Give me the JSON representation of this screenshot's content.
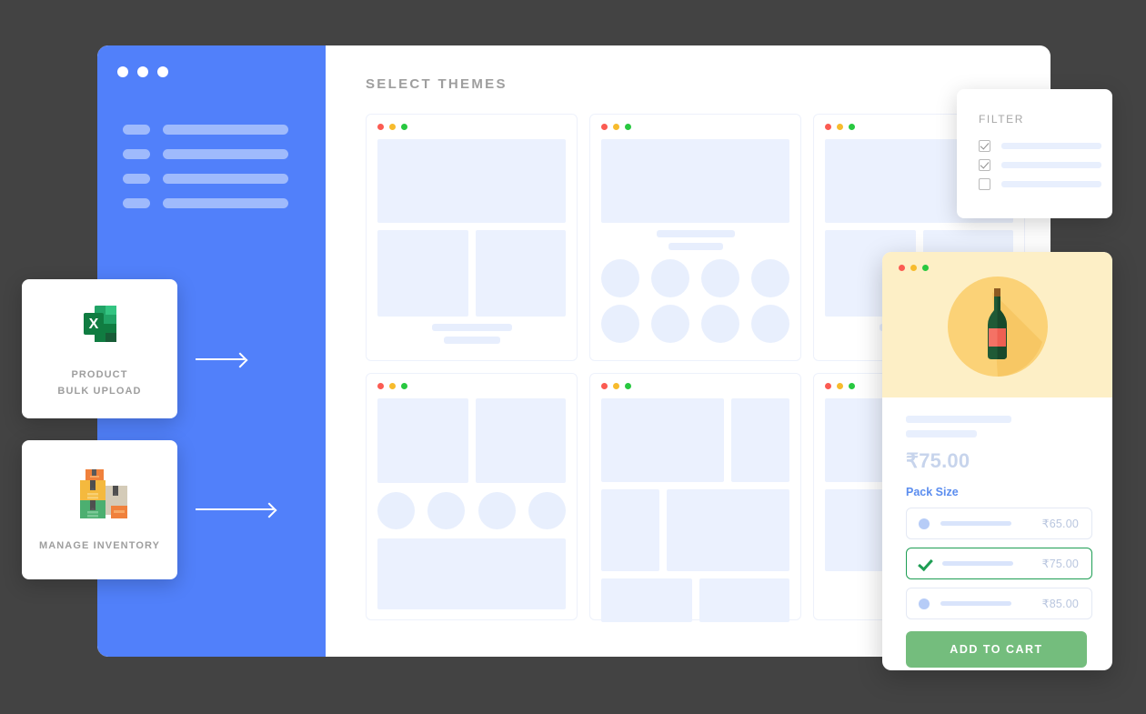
{
  "theme": {
    "page_background": "#434343",
    "sidebar_blue": "#5180FA",
    "accent_blue": "#5B8DEF",
    "skeleton_blue": "#EBF1FE",
    "green_selected": "#1E9E54",
    "cart_green": "#74BD7D",
    "hero_cream": "#FDEFC6"
  },
  "app": {
    "window_dots": [
      "dot-1",
      "dot-2",
      "dot-3"
    ],
    "sidebar": {
      "nav_items": [
        {
          "id": "nav-item-1"
        },
        {
          "id": "nav-item-2"
        },
        {
          "id": "nav-item-3"
        },
        {
          "id": "nav-item-4"
        }
      ]
    },
    "content": {
      "section_title": "SELECT THEMES",
      "theme_cards": [
        {
          "id": "theme-card-1",
          "layout": "hero-split-text"
        },
        {
          "id": "theme-card-2",
          "layout": "hero-text-circles"
        },
        {
          "id": "theme-card-3",
          "layout": "hero-split-text"
        },
        {
          "id": "theme-card-4",
          "layout": "split-circles-wide"
        },
        {
          "id": "theme-card-5",
          "layout": "masonry"
        },
        {
          "id": "theme-card-6",
          "layout": "stacked-blocks"
        }
      ],
      "card_dots": [
        "red",
        "yellow",
        "green"
      ]
    }
  },
  "feature_cards": [
    {
      "id": "card-bulk-upload",
      "icon": "excel-file-icon",
      "label_line1": "PRODUCT",
      "label_line2": "BULK UPLOAD",
      "arrow": "arrow-right-icon"
    },
    {
      "id": "card-inventory",
      "icon": "stacked-boxes-icon",
      "label_line1": "MANAGE INVENTORY",
      "label_line2": "",
      "arrow": "arrow-right-icon"
    }
  ],
  "filter_panel": {
    "title": "FILTER",
    "options": [
      {
        "id": "filter-option-1",
        "checked": true
      },
      {
        "id": "filter-option-2",
        "checked": true
      },
      {
        "id": "filter-option-3",
        "checked": false
      }
    ]
  },
  "product_panel": {
    "window_dots": [
      "red",
      "yellow",
      "green"
    ],
    "hero_icon": "wine-bottle-icon",
    "price": "₹75.00",
    "pack_size_label": "Pack Size",
    "pack_options": [
      {
        "id": "pack-option-65",
        "price": "₹65.00",
        "selected": false
      },
      {
        "id": "pack-option-75",
        "price": "₹75.00",
        "selected": true
      },
      {
        "id": "pack-option-85",
        "price": "₹85.00",
        "selected": false
      }
    ],
    "add_to_cart_label": "ADD TO CART"
  }
}
